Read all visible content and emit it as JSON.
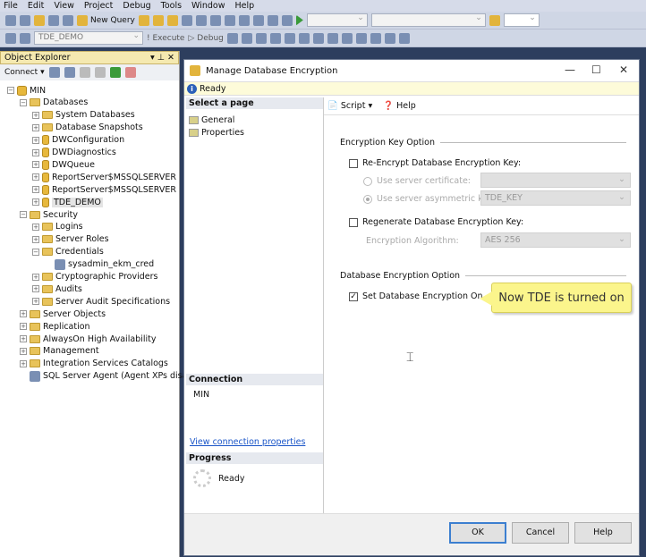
{
  "menu": [
    "File",
    "Edit",
    "View",
    "Project",
    "Debug",
    "Tools",
    "Window",
    "Help"
  ],
  "toolbar1": {
    "new_query": "New Query"
  },
  "toolbar2": {
    "database": "TDE_DEMO",
    "execute": "Execute",
    "debug": "Debug"
  },
  "object_explorer": {
    "title": "Object Explorer",
    "connect": "Connect",
    "tree": [
      {
        "label": "MIN",
        "level": 0,
        "exp": "-",
        "icon": "server"
      },
      {
        "label": "Databases",
        "level": 1,
        "exp": "-",
        "icon": "folder"
      },
      {
        "label": "System Databases",
        "level": 2,
        "exp": "+",
        "icon": "folder"
      },
      {
        "label": "Database Snapshots",
        "level": 2,
        "exp": "+",
        "icon": "folder"
      },
      {
        "label": "DWConfiguration",
        "level": 2,
        "exp": "+",
        "icon": "database"
      },
      {
        "label": "DWDiagnostics",
        "level": 2,
        "exp": "+",
        "icon": "database"
      },
      {
        "label": "DWQueue",
        "level": 2,
        "exp": "+",
        "icon": "database"
      },
      {
        "label": "ReportServer$MSSQLSERVER",
        "level": 2,
        "exp": "+",
        "icon": "database"
      },
      {
        "label": "ReportServer$MSSQLSERVER",
        "level": 2,
        "exp": "+",
        "icon": "database"
      },
      {
        "label": "TDE_DEMO",
        "level": 2,
        "exp": "+",
        "icon": "database",
        "selected": true
      },
      {
        "label": "Security",
        "level": 1,
        "exp": "-",
        "icon": "folder"
      },
      {
        "label": "Logins",
        "level": 2,
        "exp": "+",
        "icon": "folder"
      },
      {
        "label": "Server Roles",
        "level": 2,
        "exp": "+",
        "icon": "folder"
      },
      {
        "label": "Credentials",
        "level": 2,
        "exp": "-",
        "icon": "folder"
      },
      {
        "label": "sysadmin_ekm_cred",
        "level": 3,
        "exp": "",
        "icon": "credential"
      },
      {
        "label": "Cryptographic Providers",
        "level": 2,
        "exp": "+",
        "icon": "folder"
      },
      {
        "label": "Audits",
        "level": 2,
        "exp": "+",
        "icon": "folder"
      },
      {
        "label": "Server Audit Specifications",
        "level": 2,
        "exp": "+",
        "icon": "folder"
      },
      {
        "label": "Server Objects",
        "level": 1,
        "exp": "+",
        "icon": "folder"
      },
      {
        "label": "Replication",
        "level": 1,
        "exp": "+",
        "icon": "folder"
      },
      {
        "label": "AlwaysOn High Availability",
        "level": 1,
        "exp": "+",
        "icon": "folder"
      },
      {
        "label": "Management",
        "level": 1,
        "exp": "+",
        "icon": "folder"
      },
      {
        "label": "Integration Services Catalogs",
        "level": 1,
        "exp": "+",
        "icon": "folder"
      },
      {
        "label": "SQL Server Agent (Agent XPs disabl",
        "level": 1,
        "exp": "",
        "icon": "agent"
      }
    ]
  },
  "dialog": {
    "title": "Manage Database Encryption",
    "status": "Ready",
    "select_page": "Select a page",
    "pages": [
      "General",
      "Properties"
    ],
    "connection_header": "Connection",
    "connection_server": "MIN",
    "view_connection": "View connection properties",
    "progress_header": "Progress",
    "progress_status": "Ready",
    "script": "Script",
    "help_link": "Help",
    "key_option": "Encryption Key Option",
    "reencrypt": "Re-Encrypt Database Encryption Key:",
    "use_cert": "Use server certificate:",
    "use_asym": "Use server asymmetric key:",
    "asym_value": "TDE_KEY",
    "cert_value": "",
    "regenerate": "Regenerate Database Encryption Key:",
    "algorithm_label": "Encryption Algorithm:",
    "algorithm_value": "AES 256",
    "db_option": "Database Encryption Option",
    "set_on": "Set Database Encryption On",
    "set_on_checked": true,
    "callout": "Now TDE is turned on",
    "ok": "OK",
    "cancel": "Cancel",
    "help": "Help"
  }
}
